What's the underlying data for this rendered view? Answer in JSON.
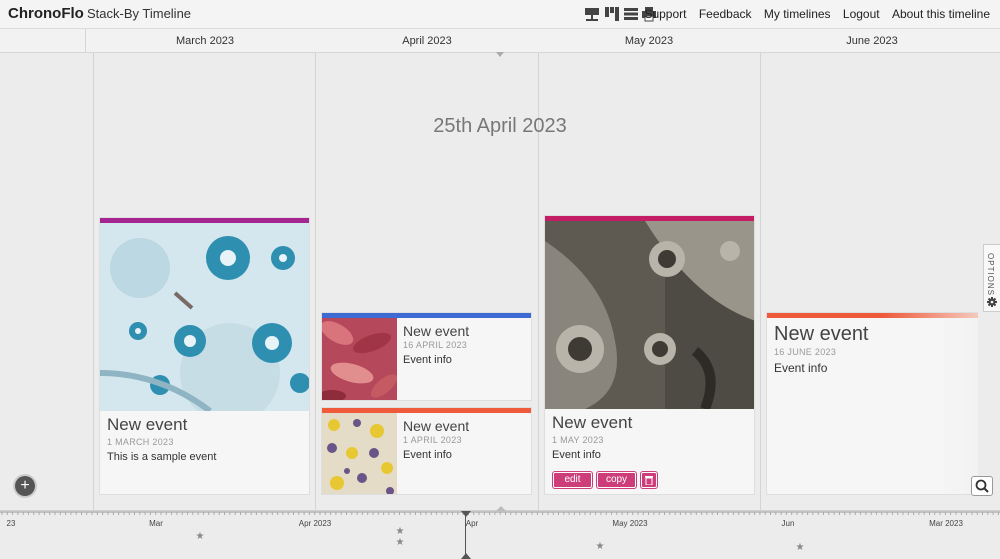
{
  "app": {
    "brand": "ChronoFlo",
    "subtitle": "Stack-By Timeline"
  },
  "view_icons": [
    "timeline-view-icon",
    "columns-view-icon",
    "list-view-icon",
    "print-icon"
  ],
  "nav": {
    "support": "Support",
    "feedback": "Feedback",
    "my_timelines": "My timelines",
    "logout": "Logout",
    "about": "About this timeline"
  },
  "months": [
    "March 2023",
    "April 2023",
    "May 2023",
    "June 2023"
  ],
  "current_date": "25th April 2023",
  "options_label": "OPTIONS",
  "colors": {
    "purple": "#a4258f",
    "blue": "#3d6bd3",
    "orange": "#ee5a3a",
    "magenta": "#c51c66",
    "button": "#cc3d7a"
  },
  "events": [
    {
      "title": "New event",
      "date": "1 MARCH 2023",
      "info": "This is a sample event",
      "color": "#a4258f"
    },
    {
      "title": "New event",
      "date": "16 APRIL 2023",
      "info": "Event info",
      "color": "#3d6bd3"
    },
    {
      "title": "New event",
      "date": "1 APRIL 2023",
      "info": "Event info",
      "color": "#ee5a3a"
    },
    {
      "title": "New event",
      "date": "1 MAY 2023",
      "info": "Event info",
      "color": "#c51c66"
    },
    {
      "title": "New event",
      "date": "16 JUNE 2023",
      "info": "Event info",
      "color": "#ee5a3a"
    }
  ],
  "card_buttons": {
    "edit": "edit",
    "copy": "copy"
  },
  "axis_labels": [
    "23",
    "Mar",
    "Apr 2023",
    "Apr",
    "May 2023",
    "Jun",
    "Mar 2023"
  ]
}
